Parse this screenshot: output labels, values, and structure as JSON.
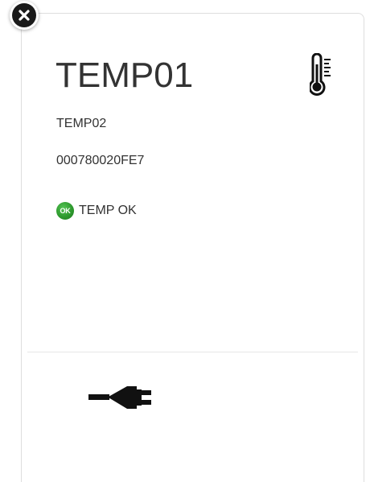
{
  "card": {
    "title": "TEMP01",
    "subtitle": "TEMP02",
    "serial": "000780020FE7",
    "status": {
      "badge": "OK",
      "text": "TEMP OK",
      "color": "#2e9a2e"
    },
    "icons": {
      "close": "close-icon",
      "sensor": "thermometer-icon",
      "power": "power-plug-icon"
    }
  }
}
